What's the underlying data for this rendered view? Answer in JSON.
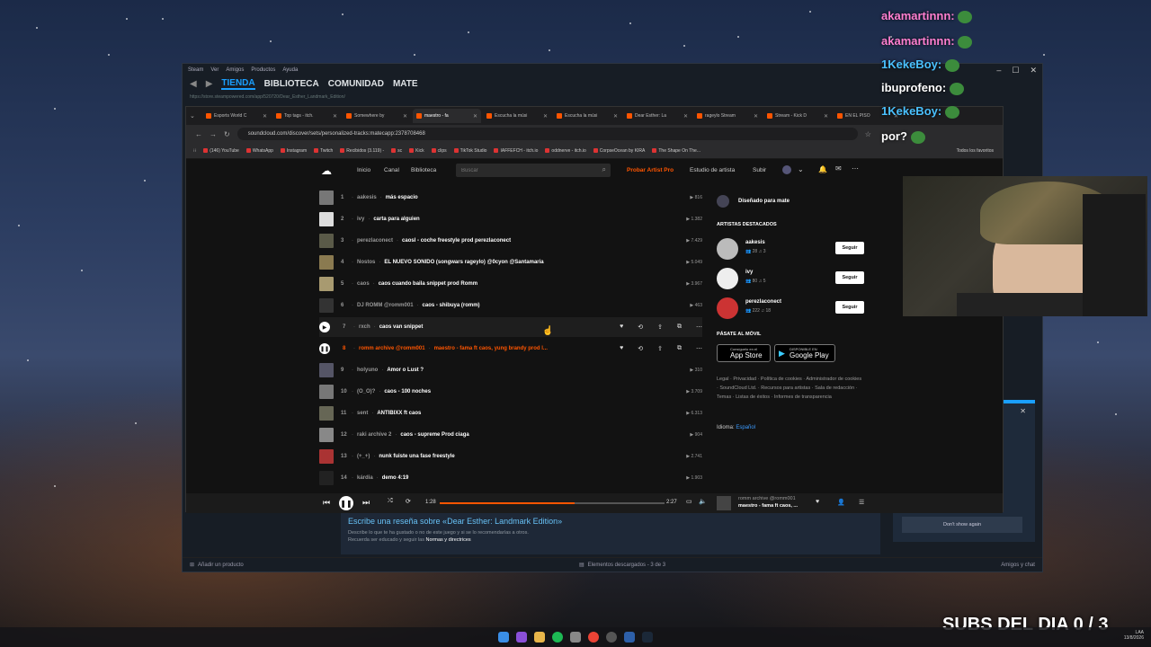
{
  "steam": {
    "menu": [
      "Steam",
      "Ver",
      "Amigos",
      "Productos",
      "Ayuda"
    ],
    "nav": [
      "TIENDA",
      "BIBLIOTECA",
      "COMUNIDAD",
      "MATE"
    ],
    "url": "https://store.steampowered.com/app/520720/Dear_Esther_Landmark_Edition/",
    "review_title": "Escribe una reseña sobre «Dear Esther: Landmark Edition»",
    "review_desc": "Describe lo que te ha gustado o no de este juego y si se lo recomendarías a otros.",
    "review_desc2": "Recuerda ser educado y seguir las",
    "review_rules": "Normas y directrices",
    "add_product": "Añadir un producto",
    "downloads": "Elementos descargados - 3 de 3",
    "friends": "Amigos y chat",
    "dont_show": "Don't show again"
  },
  "chrome": {
    "tabs": [
      "Esports World C",
      "Top tags - itch.",
      "Somewhere by",
      "maestro - fa",
      "Escucha la músi",
      "Escucha la músi",
      "Dear Esther: La",
      "rageylo Stream",
      "Stream - Kick D",
      "EN EL PISO"
    ],
    "active_tab": 3,
    "url": "soundcloud.com/discover/sets/personalized-tracks:matecapp:2378708468",
    "bookmarks": [
      "(146) YouTube",
      "WhatsApp",
      "Instagram",
      "Twitch",
      "Recibidos (3.119) -",
      "sc",
      "Kick",
      "clips",
      "TikTok Studio",
      "IAFFEFCH - itch.io",
      "oddnerve - itch.io",
      "CorpseOcean by KIRA",
      "The Shape On The..."
    ],
    "all_bookmarks": "Todos los favoritos"
  },
  "soundcloud": {
    "nav": [
      "Inicio",
      "Canal",
      "Biblioteca"
    ],
    "search_placeholder": "Buscar",
    "pro": "Probar Artist Pro",
    "studio": "Estudio de artista",
    "upload": "Subir",
    "tracks": [
      {
        "n": "1",
        "artist": "aakesis",
        "title": "más espacio",
        "plays": "816",
        "color": "#777"
      },
      {
        "n": "2",
        "artist": "ivy",
        "title": "carta para alguien",
        "plays": "1.382",
        "color": "#ddd"
      },
      {
        "n": "3",
        "artist": "perezlaconect",
        "title": "caosl - coche freestyle prod perezlaconect",
        "plays": "7.429",
        "color": "#5a5a48"
      },
      {
        "n": "4",
        "artist": "Nostos",
        "title": "EL NUEVO SONIDO (songwars rageylo) @0cyon @Santamaria",
        "plays": "5.049",
        "color": "#8a7a50"
      },
      {
        "n": "5",
        "artist": "caos",
        "title": "caos cuando baila snippet prod Romm",
        "plays": "3.967",
        "color": "#a89a70"
      },
      {
        "n": "6",
        "artist": "DJ ROMM @romm001",
        "title": "caos - shibuya (romm)",
        "plays": "463",
        "color": "#333"
      },
      {
        "n": "7",
        "artist": "rxch",
        "title": "caos van snippet",
        "plays": "",
        "color": "#555"
      },
      {
        "n": "8",
        "artist": "romm archive @romm001",
        "title": "maestro - fama ft caos, yung brandy prod l...",
        "plays": "",
        "color": "#444"
      },
      {
        "n": "9",
        "artist": "holyuno",
        "title": "Amor o Lust ?",
        "plays": "310",
        "color": "#556"
      },
      {
        "n": "10",
        "artist": "(O_O)?",
        "title": "caos - 100 noches",
        "plays": "3.709",
        "color": "#777"
      },
      {
        "n": "11",
        "artist": "sent",
        "title": "ANTIBIXX ft caos",
        "plays": "6.313",
        "color": "#665"
      },
      {
        "n": "12",
        "artist": "raki archive 2",
        "title": "caos - supreme Prod ciaga",
        "plays": "904",
        "color": "#888"
      },
      {
        "n": "13",
        "artist": "(+_+)",
        "title": "nunk fuiste una fase freestyle",
        "plays": "2.741",
        "color": "#a33"
      },
      {
        "n": "14",
        "artist": "kárdia",
        "title": "demo 4:19",
        "plays": "1.903",
        "color": "#222"
      }
    ],
    "side": {
      "designed": "Diseñado para mate",
      "featured": "ARTISTAS DESTACADOS",
      "artists": [
        {
          "name": "aakesis",
          "followers": "28",
          "tracks": "3"
        },
        {
          "name": "ivy",
          "followers": "80",
          "tracks": "5"
        },
        {
          "name": "perezlaconect",
          "followers": "222",
          "tracks": "18"
        }
      ],
      "follow": "Seguir",
      "mobile": "PÁSATE AL MÓVIL",
      "appstore_small": "Consíguelo en el",
      "appstore": "App Store",
      "gplay_small": "DISPONIBLE EN",
      "gplay": "Google Play",
      "legal": "Legal · Privacidad · Política de cookies · Administrador de cookies · SoundCloud Ltd. · Recursos para artistas · Sala de redacción · Temas · Listas de éxitos · Informes de transparencia",
      "lang_label": "Idioma:",
      "lang": "Español"
    },
    "player": {
      "elapsed": "1:28",
      "total": "2:27",
      "progress": 0.6,
      "artist": "romm archive @romm001",
      "title": "maestro - fama ft caos, ..."
    }
  },
  "chat": [
    {
      "user": "akamartinnn:"
    },
    {
      "user": "akamartinnn:"
    },
    {
      "user": "1KekeBoy:"
    },
    {
      "user": "ibuprofeno:"
    },
    {
      "user": "1KekeBoy:"
    },
    {
      "user": "",
      "text": "por?"
    }
  ],
  "subs": "SUBS DEL DIA 0 / 3",
  "tray": {
    "lang": "LAA",
    "time": "...",
    "date": "13/8/2026"
  },
  "colors": {
    "accent": "#ff5500",
    "steam_blue": "#1a9fff"
  }
}
